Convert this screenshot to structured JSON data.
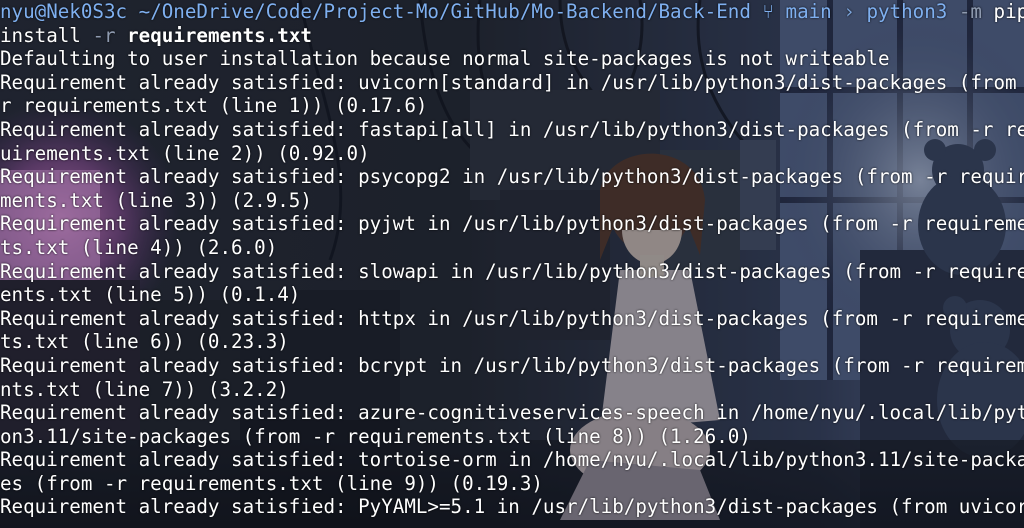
{
  "prompt": {
    "user_host": "nyu@Nek0S3c",
    "path": "~/OneDrive/Code/Project-Mo/GitHub/Mo-Backend/Back-End",
    "branch_icon": "git-branch-icon",
    "branch": "main",
    "separator": "›",
    "command": "python3",
    "flag_m": "-m",
    "pip": "pip",
    "install": "install",
    "flag_r": "-r",
    "requirements_file": "requirements.txt"
  },
  "output": [
    "Defaulting to user installation because normal site-packages is not writeable",
    "Requirement already satisfied: uvicorn[standard] in /usr/lib/python3/dist-packages (from -",
    "r requirements.txt (line 1)) (0.17.6)",
    "Requirement already satisfied: fastapi[all] in /usr/lib/python3/dist-packages (from -r req",
    "uirements.txt (line 2)) (0.92.0)",
    "Requirement already satisfied: psycopg2 in /usr/lib/python3/dist-packages (from -r require",
    "ments.txt (line 3)) (2.9.5)",
    "Requirement already satisfied: pyjwt in /usr/lib/python3/dist-packages (from -r requiremen",
    "ts.txt (line 4)) (2.6.0)",
    "Requirement already satisfied: slowapi in /usr/lib/python3/dist-packages (from -r requirem",
    "ents.txt (line 5)) (0.1.4)",
    "Requirement already satisfied: httpx in /usr/lib/python3/dist-packages (from -r requiremen",
    "ts.txt (line 6)) (0.23.3)",
    "Requirement already satisfied: bcrypt in /usr/lib/python3/dist-packages (from -r requireme",
    "nts.txt (line 7)) (3.2.2)",
    "Requirement already satisfied: azure-cognitiveservices-speech in /home/nyu/.local/lib/pyth",
    "on3.11/site-packages (from -r requirements.txt (line 8)) (1.26.0)",
    "Requirement already satisfied: tortoise-orm in /home/nyu/.local/lib/python3.11/site-packag",
    "es (from -r requirements.txt (line 9)) (0.19.3)",
    "Requirement already satisfied: PyYAML>=5.1 in /usr/lib/python3/dist-packages (from uvicorn"
  ],
  "colors": {
    "prompt_blue": "#7fb0f0",
    "flag_gray": "#8f9bb0",
    "text_white": "#ffffff",
    "background": "#1c2230"
  }
}
